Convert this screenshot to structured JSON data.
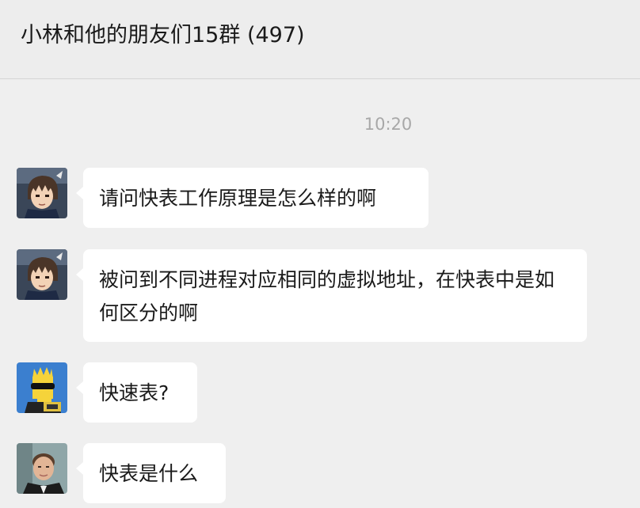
{
  "header": {
    "title": "小林和他的朋友们15群 (497)"
  },
  "chat": {
    "timestamp": "10:20",
    "messages": [
      {
        "avatar": "anime-boy-avatar-icon",
        "text": "请问快表工作原理是怎么样的啊"
      },
      {
        "avatar": "anime-boy-avatar-icon",
        "text": "被问到不同进程对应相同的虚拟地址，在快表中是如何区分的啊"
      },
      {
        "avatar": "cartoon-character-avatar-icon",
        "text": "快速表?"
      },
      {
        "avatar": "man-photo-avatar-icon",
        "text": "快表是什么"
      }
    ]
  },
  "colors": {
    "background": "#ededed",
    "bubble": "#ffffff",
    "timestamp": "#a8a8a8"
  }
}
